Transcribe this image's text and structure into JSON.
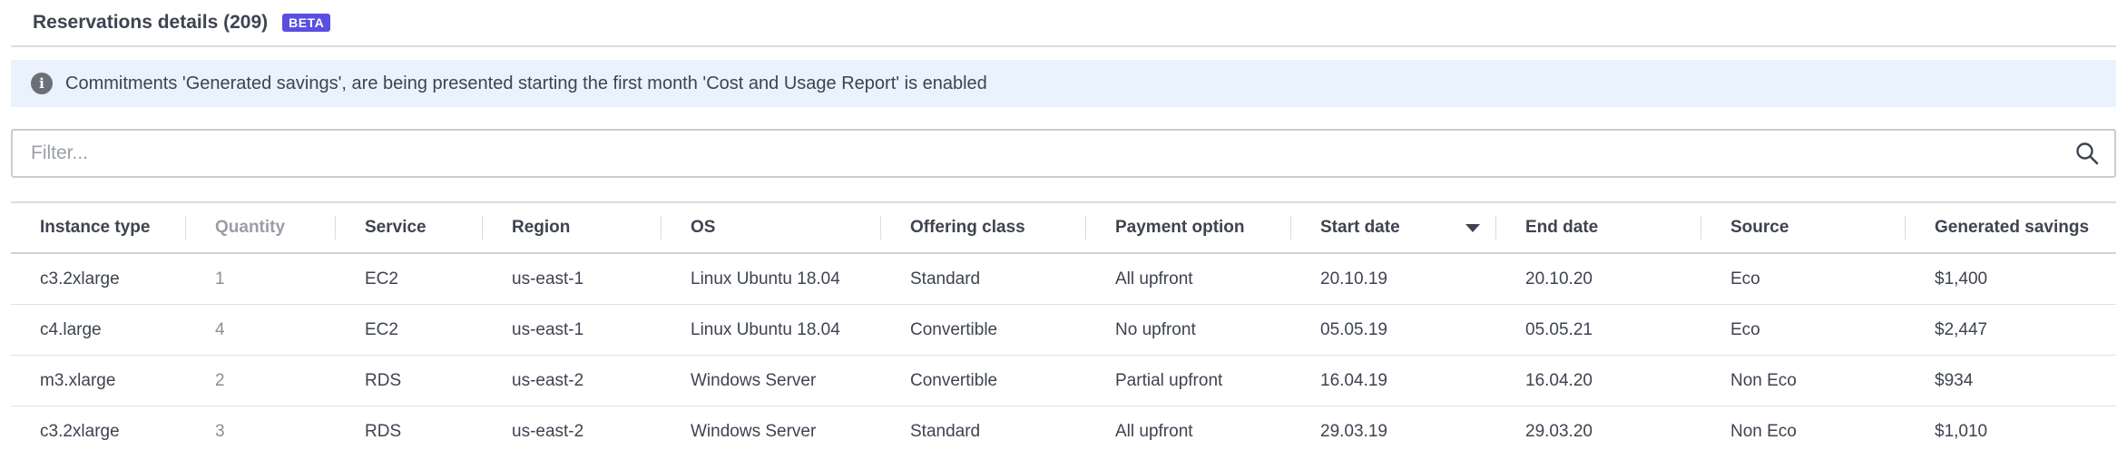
{
  "header": {
    "title": "Reservations details (209)",
    "badge": "BETA"
  },
  "notice": {
    "icon": "info-icon",
    "text": "Commitments 'Generated savings', are being presented starting the first month 'Cost and Usage Report' is enabled"
  },
  "filter": {
    "placeholder": "Filter...",
    "value": "",
    "icon": "search-icon"
  },
  "table": {
    "columns": [
      "Instance type",
      "Quantity",
      "Service",
      "Region",
      "OS",
      "Offering class",
      "Payment option",
      "Start date",
      "End date",
      "Source",
      "Generated savings"
    ],
    "sorted_column": "Start date",
    "sort_direction": "descending",
    "rows": [
      [
        "c3.2xlarge",
        "1",
        "EC2",
        "us-east-1",
        "Linux Ubuntu 18.04",
        "Standard",
        "All upfront",
        "20.10.19",
        "20.10.20",
        "Eco",
        "$1,400"
      ],
      [
        "c4.large",
        "4",
        "EC2",
        "us-east-1",
        "Linux Ubuntu 18.04",
        "Convertible",
        "No upfront",
        "05.05.19",
        "05.05.21",
        "Eco",
        "$2,447"
      ],
      [
        "m3.xlarge",
        "2",
        "RDS",
        "us-east-2",
        "Windows Server",
        "Convertible",
        "Partial upfront",
        "16.04.19",
        "16.04.20",
        "Non Eco",
        "$934"
      ],
      [
        "c3.2xlarge",
        "3",
        "RDS",
        "us-east-2",
        "Windows Server",
        "Standard",
        "All upfront",
        "29.03.19",
        "29.03.20",
        "Non Eco",
        "$1,010"
      ]
    ]
  },
  "colors": {
    "badge_bg": "#5a4fe0",
    "notice_bg": "#eaf2fd",
    "text": "#3e4350",
    "muted": "#9a9ea7"
  }
}
